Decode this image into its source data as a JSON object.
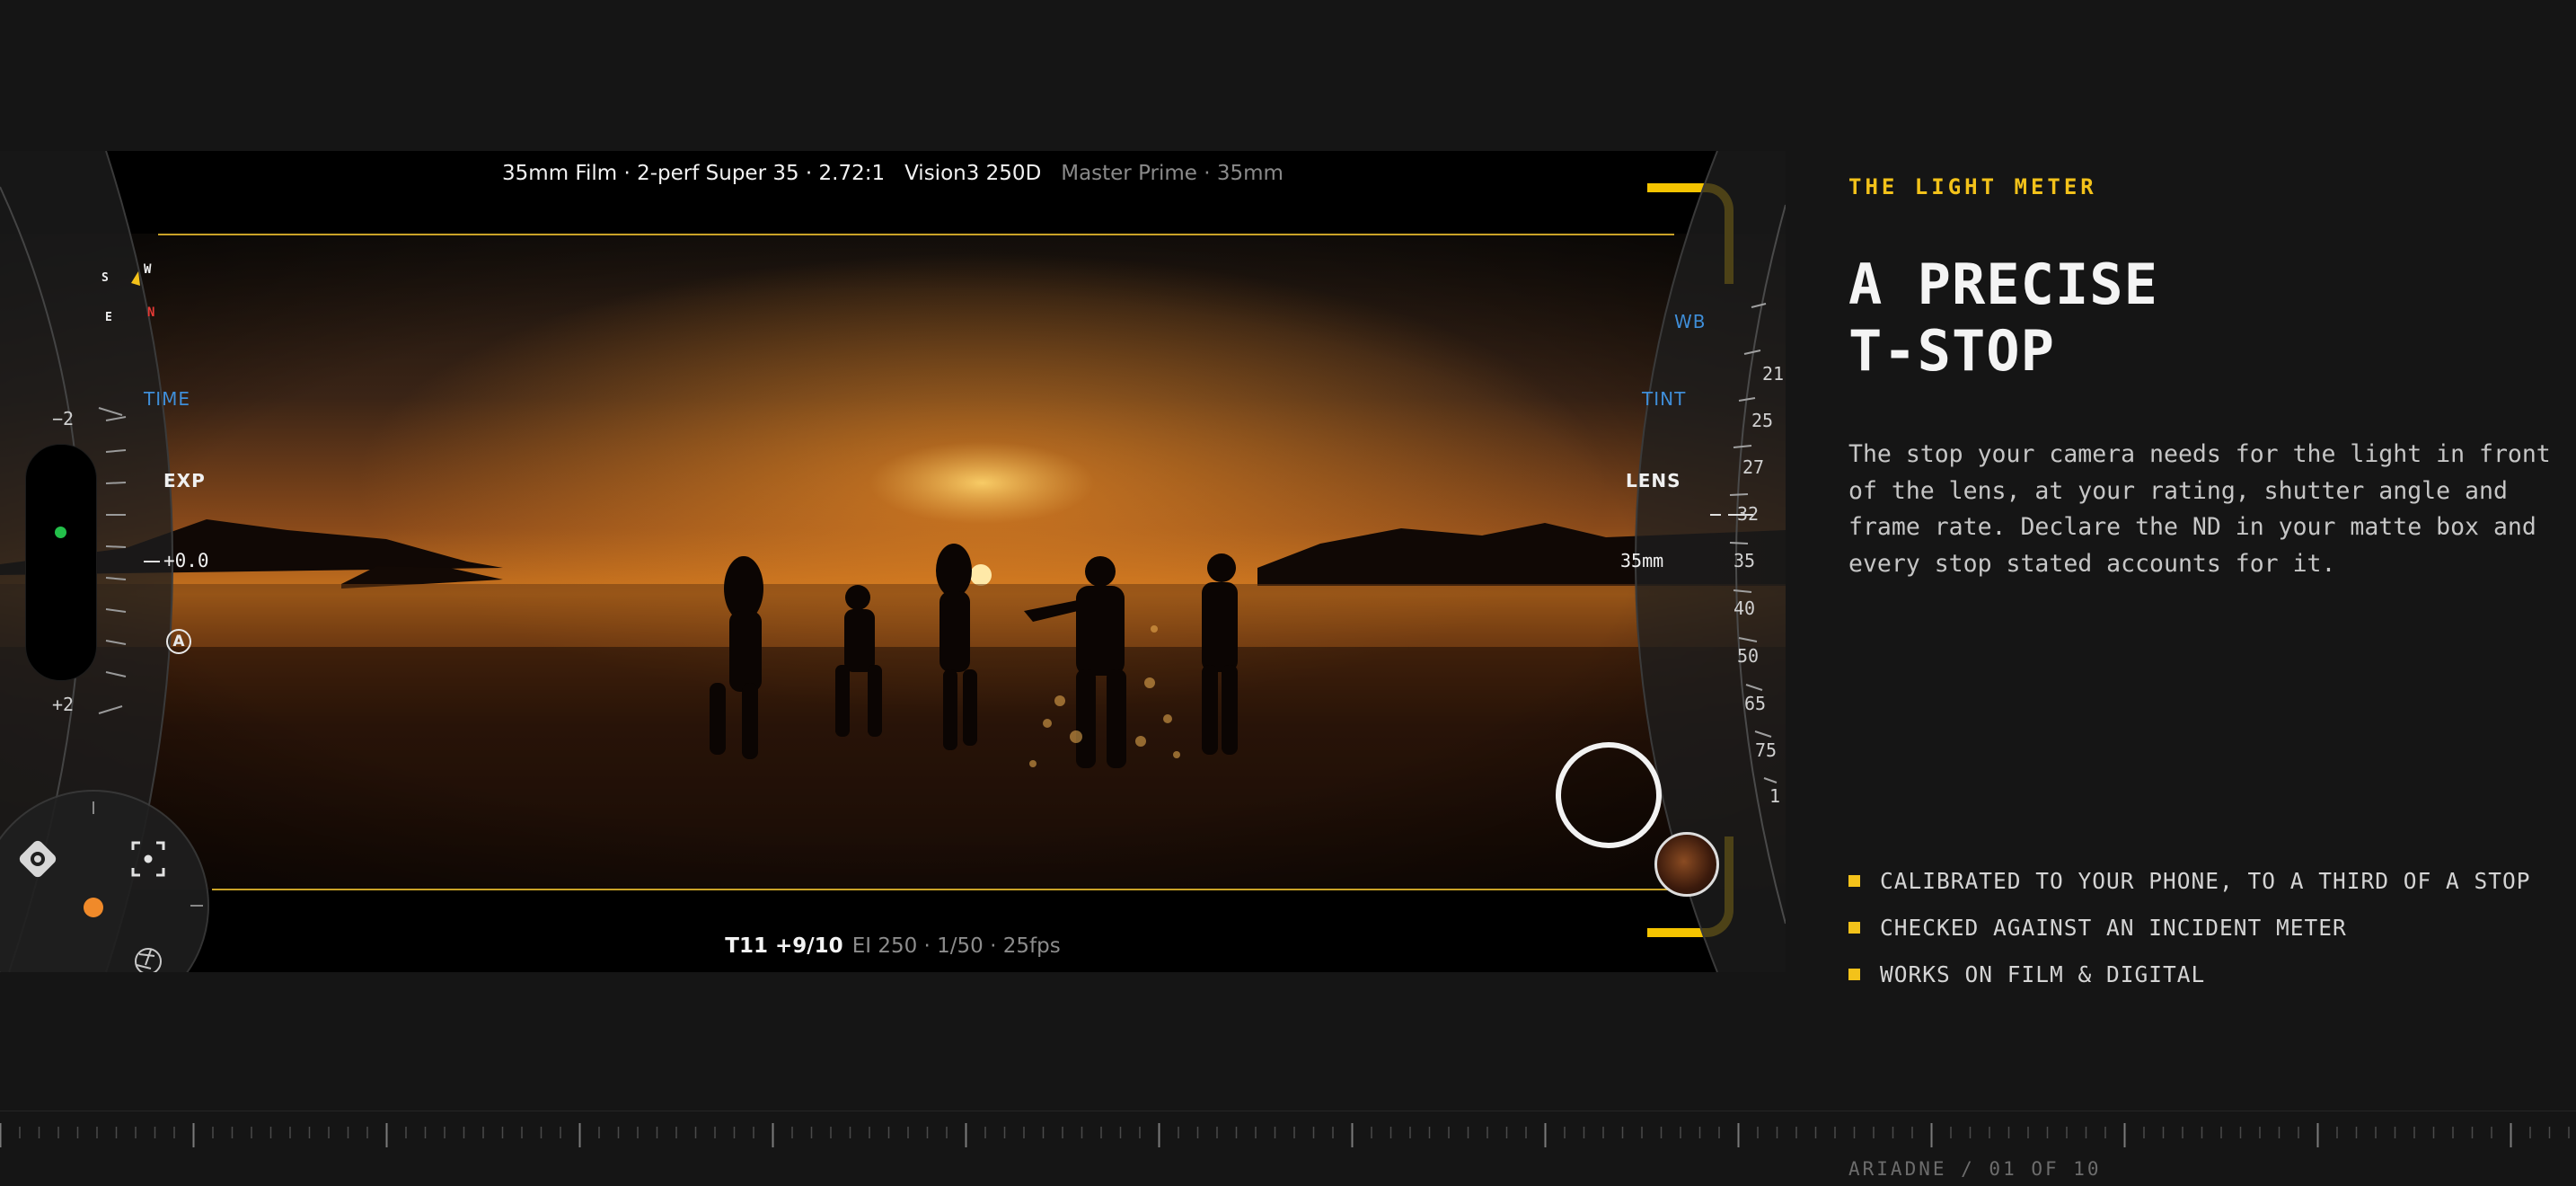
{
  "viewfinder": {
    "top_hud": {
      "format": "35mm Film · 2-perf Super 35 · 2.72:1",
      "stock": "Vision3 250D",
      "lens": "Master Prime · 35mm"
    },
    "bottom_hud": {
      "tstop": "T11 +9/10",
      "settings": "EI 250 · 1/50 · 25fps"
    },
    "left_dial": {
      "compass": {
        "s": "S",
        "w": "W",
        "e": "E",
        "n": "N"
      },
      "mode_time": "TIME",
      "mode_exp": "EXP",
      "exposure_value": "+0.0",
      "scale_min": "−2",
      "scale_max": "+2",
      "auto_badge": "A"
    },
    "right_dial": {
      "mode_wb": "WB",
      "mode_tint": "TINT",
      "mode_lens": "LENS",
      "current_focal": "35mm",
      "focal_ticks": [
        "21",
        "25",
        "27",
        "32",
        "35",
        "40",
        "50",
        "65",
        "75",
        "1"
      ]
    }
  },
  "panel": {
    "eyebrow": "THE LIGHT METER",
    "headline_line1": "A PRECISE",
    "headline_line2": "T-STOP",
    "body": "The stop your camera needs for the light in front of the lens, at your rating, shutter angle and frame rate. Declare the ND in your matte box and every stop stated accounts for it.",
    "features": [
      "CALIBRATED TO YOUR PHONE, TO A THIRD OF A STOP",
      "CHECKED AGAINST AN INCIDENT METER",
      "WORKS ON FILM & DIGITAL"
    ]
  },
  "footer": {
    "pager": "ARIADNE / 01 OF 10"
  },
  "colors": {
    "accent": "#f3c21a",
    "background": "#151515",
    "dial_blue": "#3f8ed8"
  }
}
